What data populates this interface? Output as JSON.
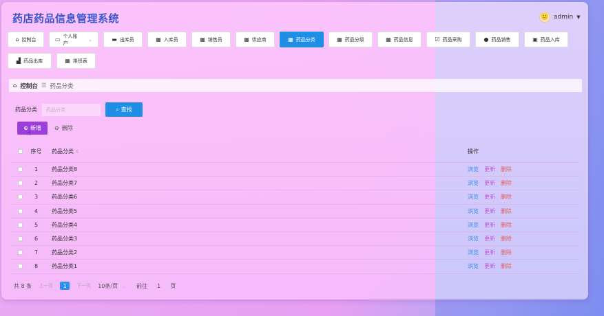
{
  "app": {
    "title": "药店药品信息管理系统"
  },
  "user": {
    "name": "admin"
  },
  "nav": [
    {
      "label": "控制台",
      "icon": "home-icon"
    },
    {
      "label": "个人账户",
      "icon": "id-card-icon",
      "dropdown": true
    },
    {
      "label": "出库员",
      "icon": "monitor-icon"
    },
    {
      "label": "入库员",
      "icon": "grid-icon"
    },
    {
      "label": "销售员",
      "icon": "grid-icon"
    },
    {
      "label": "供应商",
      "icon": "grid-icon"
    },
    {
      "label": "药品分类",
      "icon": "grid-icon",
      "active": true
    },
    {
      "label": "药品分级",
      "icon": "grid-icon"
    },
    {
      "label": "药品信息",
      "icon": "grid-icon"
    },
    {
      "label": "药品采购",
      "icon": "checkbox-icon"
    },
    {
      "label": "药品销售",
      "icon": "user-icon"
    },
    {
      "label": "药品入库",
      "icon": "briefcase-icon"
    },
    {
      "label": "药品出库",
      "icon": "chart-icon"
    },
    {
      "label": "排班表",
      "icon": "grid-icon"
    }
  ],
  "breadcrumb": {
    "home": "控制台",
    "current": "药品分类"
  },
  "search": {
    "label": "药品分类",
    "placeholder": "药品分类",
    "button": "查找"
  },
  "actions": {
    "add": "新增",
    "delete": "删除"
  },
  "table": {
    "headers": {
      "index": "序号",
      "name": "药品分类",
      "ops": "操作"
    },
    "ops": {
      "view": "浏览",
      "edit": "更新",
      "delete": "删除"
    },
    "rows": [
      {
        "index": "1",
        "name": "药品分类8"
      },
      {
        "index": "2",
        "name": "药品分类7"
      },
      {
        "index": "3",
        "name": "药品分类6"
      },
      {
        "index": "4",
        "name": "药品分类5"
      },
      {
        "index": "5",
        "name": "药品分类4"
      },
      {
        "index": "6",
        "name": "药品分类3"
      },
      {
        "index": "7",
        "name": "药品分类2"
      },
      {
        "index": "8",
        "name": "药品分类1"
      }
    ]
  },
  "pager": {
    "total": "共 8 条",
    "prev": "上一页",
    "current": "1",
    "next": "下一页",
    "page_size": "10条/页",
    "goto": "前往",
    "goto_value": "1",
    "page_unit": "页"
  },
  "colors": {
    "accent": "#1f8fe6",
    "add_button": "#9b3fdc",
    "title": "#3a56c8"
  }
}
